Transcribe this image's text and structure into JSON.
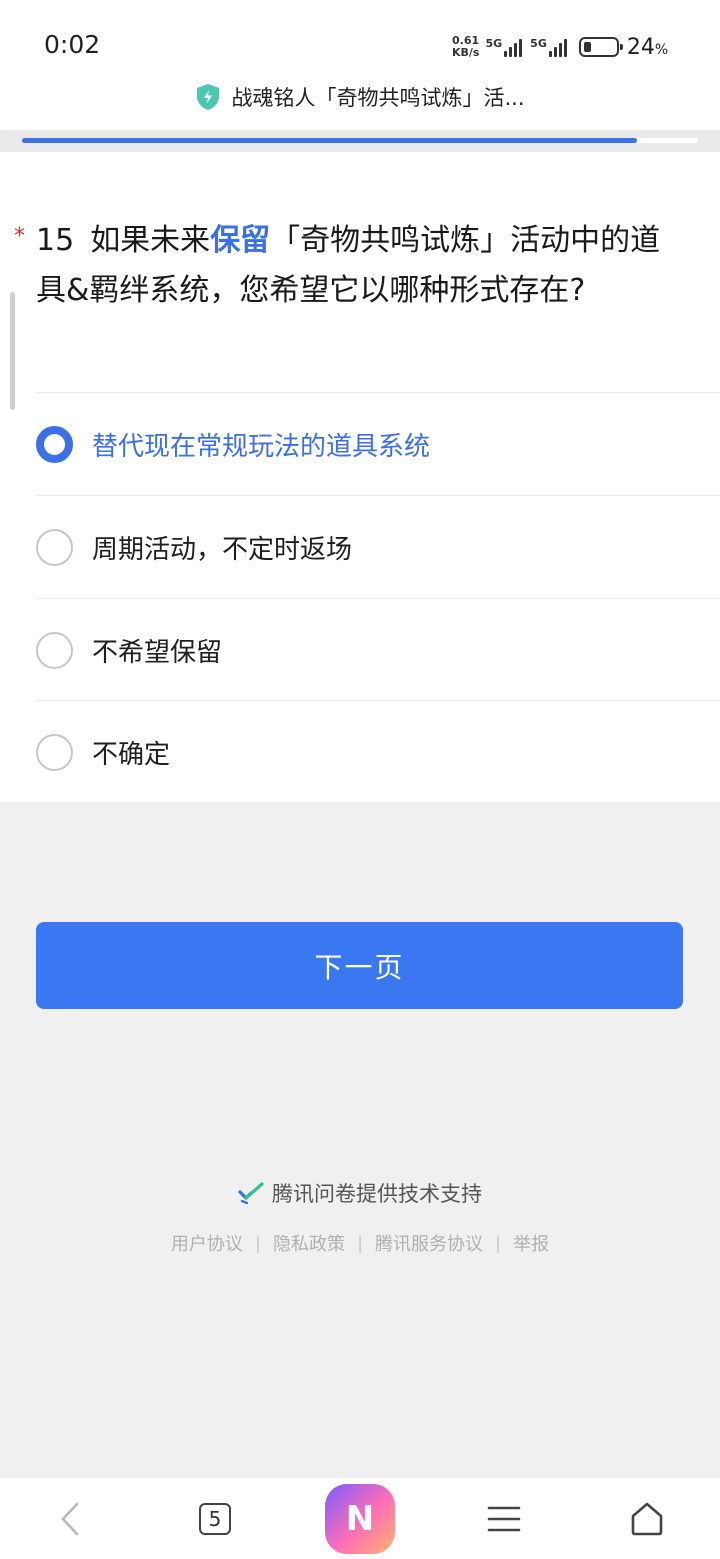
{
  "status_bar": {
    "time": "0:02",
    "net_speed_value": "0.61",
    "net_speed_unit": "KB/s",
    "sim1_label": "5G",
    "sim2_label": "5G",
    "battery_percent": "24",
    "battery_percent_symbol": "%",
    "battery_level": 0.24
  },
  "header": {
    "title": "战魂铭人「奇物共鸣试炼」活..."
  },
  "progress": {
    "fraction": 0.91
  },
  "question": {
    "required_mark": "*",
    "number": "15",
    "text_before": "如果未来",
    "text_highlight": "保留",
    "text_after": "「奇物共鸣试炼」活动中的道具&羁绊系统，您希望它以哪种形式存在?"
  },
  "options": [
    {
      "label": "替代现在常规玩法的道具系统",
      "selected": true
    },
    {
      "label": "周期活动，不定时返场",
      "selected": false
    },
    {
      "label": "不希望保留",
      "selected": false
    },
    {
      "label": "不确定",
      "selected": false
    }
  ],
  "next_button": {
    "label": "下一页"
  },
  "footer": {
    "powered_by": "腾讯问卷提供技术支持",
    "links": [
      "用户协议",
      "隐私政策",
      "腾讯服务协议",
      "举报"
    ],
    "separator": "|"
  },
  "bottom_nav": {
    "tab_count": "5",
    "app_logo_letter": "N"
  },
  "colors": {
    "accent": "#3a70e8",
    "button": "#3a78f2",
    "required": "#e0352b"
  }
}
